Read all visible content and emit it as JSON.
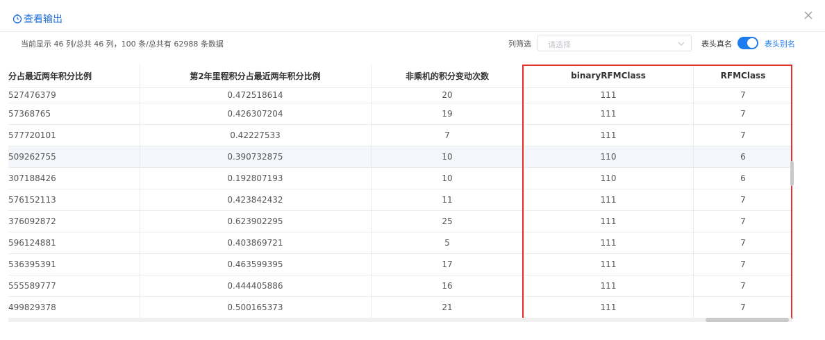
{
  "header": {
    "title": "查看输出"
  },
  "toolbar": {
    "summary": "当前显示 46 列/总共 46 列，100 条/总共有 62988 条数据",
    "filter_label": "列筛选",
    "filter_placeholder": "请选择",
    "toggle_label": "表头真名",
    "toggle_on": true,
    "alias_label": "表头别名"
  },
  "table": {
    "columns": [
      "分占最近两年积分比例",
      "第2年里程积分占最近两年积分比例",
      "非乘机的积分变动次数",
      "binaryRFMClass",
      "RFMClass"
    ],
    "rows": [
      [
        "527476379",
        "0.472518614",
        "20",
        "111",
        "7"
      ],
      [
        "57368765",
        "0.426307204",
        "19",
        "111",
        "7"
      ],
      [
        "577720101",
        "0.42227533",
        "7",
        "111",
        "7"
      ],
      [
        "509262755",
        "0.390732875",
        "10",
        "110",
        "6"
      ],
      [
        "307188426",
        "0.192807193",
        "10",
        "110",
        "6"
      ],
      [
        "576152113",
        "0.423842432",
        "11",
        "111",
        "7"
      ],
      [
        "376092872",
        "0.623902295",
        "25",
        "111",
        "7"
      ],
      [
        "596124881",
        "0.403869721",
        "5",
        "111",
        "7"
      ],
      [
        "536395391",
        "0.463599395",
        "17",
        "111",
        "7"
      ],
      [
        "555589777",
        "0.444405886",
        "16",
        "111",
        "7"
      ],
      [
        "499829378",
        "0.500165373",
        "21",
        "111",
        "7"
      ]
    ],
    "highlighted_row": 3
  },
  "colors": {
    "accent": "#1e7bf0",
    "highlight_box": "#e4322b"
  }
}
